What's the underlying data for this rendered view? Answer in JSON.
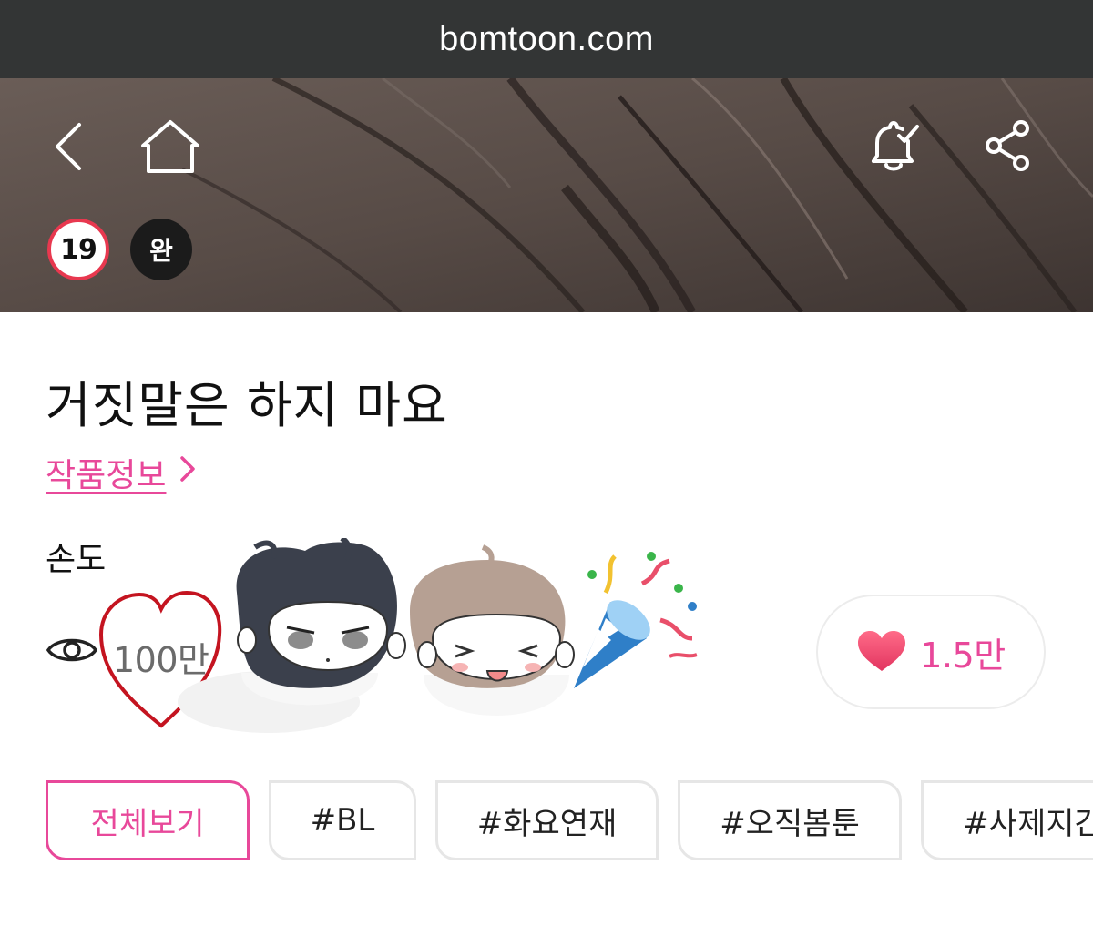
{
  "browser": {
    "url": "bomtoon.com"
  },
  "header": {
    "back_icon": "chevron-left-icon",
    "home_icon": "home-icon",
    "bell_icon": "bell-check-icon",
    "share_icon": "share-icon"
  },
  "badges": {
    "age": "19",
    "status": "완"
  },
  "work": {
    "title": "거짓말은 하지 마요",
    "info_link": "작품정보",
    "author": "손도",
    "views": "100만",
    "likes": "1.5만"
  },
  "tags": [
    "전체보기",
    "#BL",
    "#화요연재",
    "#오직봄툰",
    "#사제지간"
  ],
  "colors": {
    "accent": "#e8489a",
    "age_badge_ring": "#e8384f",
    "url_bar": "#333535"
  }
}
